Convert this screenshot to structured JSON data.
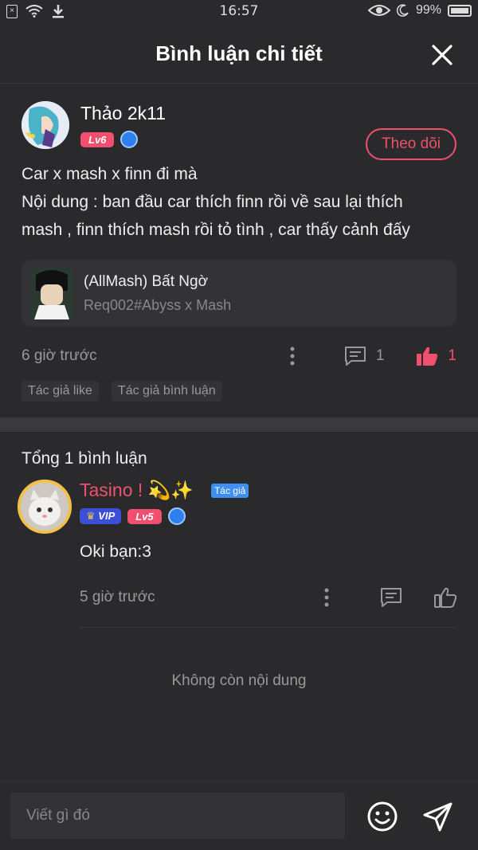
{
  "status_bar": {
    "time": "16:57",
    "battery": "99%"
  },
  "header": {
    "title": "Bình luận chi tiết"
  },
  "post": {
    "author_name": "Thảo 2k11",
    "level": "Lv6",
    "follow_label": "Theo dõi",
    "content_lines": [
      "Car x mash x finn đi mà",
      "Nội dung : ban đầu car thích finn rồi về sau lại thích",
      "mash , finn thích mash rồi tỏ tình , car thấy cảnh đấy"
    ],
    "linked_story": {
      "title": "(AllMash) Bất Ngờ",
      "subtitle": "Req002#Abyss x Mash"
    },
    "time": "6 giờ trước",
    "comment_count": "1",
    "like_count": "1",
    "tags": [
      "Tác giả like",
      "Tác giả bình luận"
    ],
    "colors": {
      "accent": "#f0506e"
    }
  },
  "comments_section": {
    "title": "Tổng 1 bình luận",
    "comments": [
      {
        "name": "Tasino ! 💫✨",
        "author_tag": "Tác giả",
        "vip": "VIP",
        "level": "Lv5",
        "text": "Oki bạn:3",
        "time": "5 giờ trước"
      }
    ],
    "no_more": "Không còn nội dung"
  },
  "bottom_bar": {
    "input_placeholder": "Viết gì đó"
  }
}
